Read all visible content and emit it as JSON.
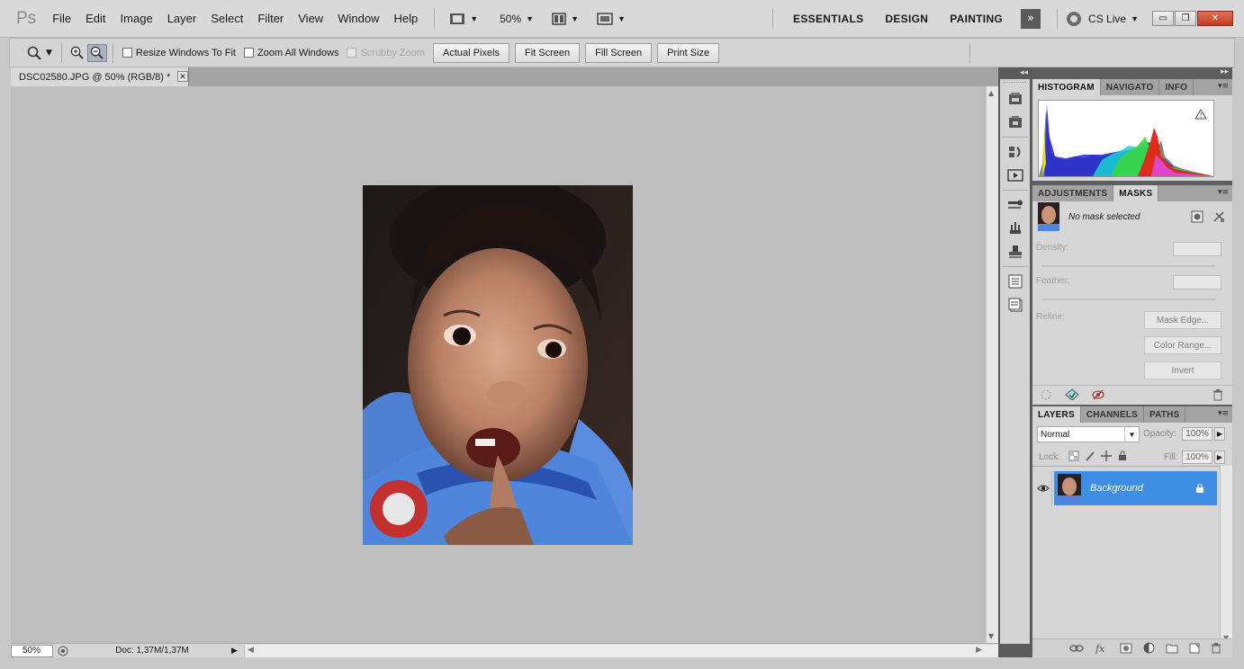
{
  "app": {
    "logo": "Ps",
    "menu": [
      "File",
      "Edit",
      "Image",
      "Layer",
      "Select",
      "Filter",
      "View",
      "Window",
      "Help"
    ],
    "zoom_select": "50%",
    "workspaces": [
      "ESSENTIALS",
      "DESIGN",
      "PAINTING"
    ],
    "more": "»",
    "cs_live": "CS Live",
    "window_controls": {
      "minimize": "▭",
      "restore": "❐",
      "close": "✕"
    }
  },
  "options": {
    "checks": [
      {
        "label": "Resize Windows To Fit",
        "disabled": false
      },
      {
        "label": "Zoom All Windows",
        "disabled": false
      },
      {
        "label": "Scrubby Zoom",
        "disabled": true
      }
    ],
    "buttons": [
      "Actual Pixels",
      "Fit Screen",
      "Fill Screen",
      "Print Size"
    ]
  },
  "document": {
    "tab_title": "DSC02580.JPG @ 50% (RGB/8) *",
    "close": "✕"
  },
  "status": {
    "zoom": "50%",
    "doc_info": "Doc: 1,37M/1,37M"
  },
  "panels": {
    "collapse_left": "◂◂",
    "collapse_right": "▸▸",
    "group1_tabs": [
      "HISTOGRAM",
      "NAVIGATO",
      "INFO"
    ],
    "group2_tabs": [
      "ADJUSTMENTS",
      "MASKS"
    ],
    "masks": {
      "no_mask": "No mask selected",
      "density_label": "Density:",
      "feather_label": "Feather:",
      "refine_label": "Refine:",
      "buttons": [
        "Mask Edge...",
        "Color Range...",
        "Invert"
      ]
    },
    "group3_tabs": [
      "LAYERS",
      "CHANNELS",
      "PATHS"
    ],
    "layers": {
      "blend_mode": "Normal",
      "opacity_label": "Opacity:",
      "opacity_value": "100%",
      "lock_label": "Lock:",
      "fill_label": "Fill:",
      "fill_value": "100%",
      "layer_name": "Background"
    },
    "menu_glyph": "▾≡"
  },
  "colors": {
    "selection_blue": "#3d8ee4",
    "close_red": "#c33a20"
  }
}
